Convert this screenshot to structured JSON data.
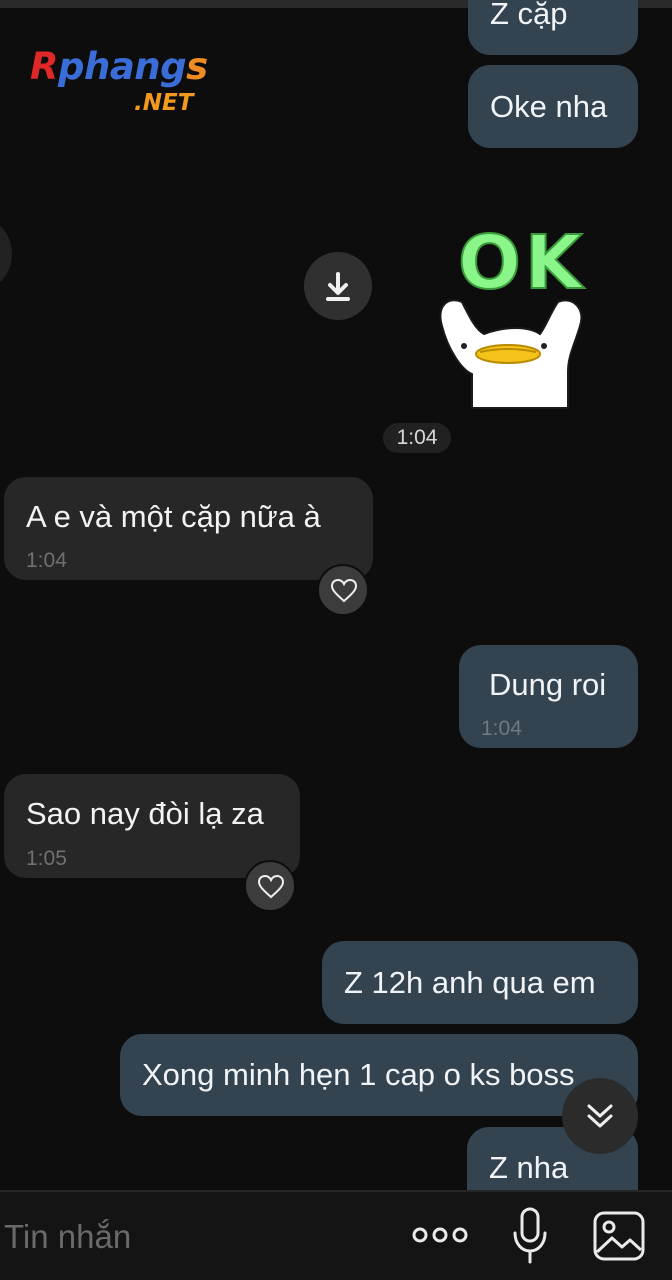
{
  "logo": {
    "main_r": "R",
    "main_p": "phang",
    "main_s": "s",
    "sub": ".NET"
  },
  "messages": [
    {
      "id": "m1",
      "direction": "out",
      "text": "Z cặp"
    },
    {
      "id": "m2",
      "direction": "out",
      "text": "Oke nha"
    },
    {
      "id": "m3",
      "direction": "out",
      "type": "sticker",
      "sticker_text": "OK",
      "time": "1:04"
    },
    {
      "id": "m4",
      "direction": "in",
      "text": "A e và một cặp nữa à",
      "time": "1:04"
    },
    {
      "id": "m5",
      "direction": "out",
      "text": "Dung roi",
      "time": "1:04"
    },
    {
      "id": "m6",
      "direction": "in",
      "text": "Sao nay đòi lạ za",
      "time": "1:05"
    },
    {
      "id": "m7",
      "direction": "out",
      "text": "Z 12h anh qua em"
    },
    {
      "id": "m8",
      "direction": "out",
      "text": "Xong minh hẹn 1 cap o ks boss"
    },
    {
      "id": "m9",
      "direction": "out",
      "text": "Z nha"
    }
  ],
  "composer": {
    "placeholder": "Tin nhắn",
    "icons": [
      "more-icon",
      "microphone-icon",
      "gallery-icon"
    ]
  },
  "colors": {
    "background": "#0d0d0d",
    "outgoing_bubble": "#344350",
    "incoming_bubble": "#272727",
    "sticker_ok_green": "#8af68a"
  }
}
